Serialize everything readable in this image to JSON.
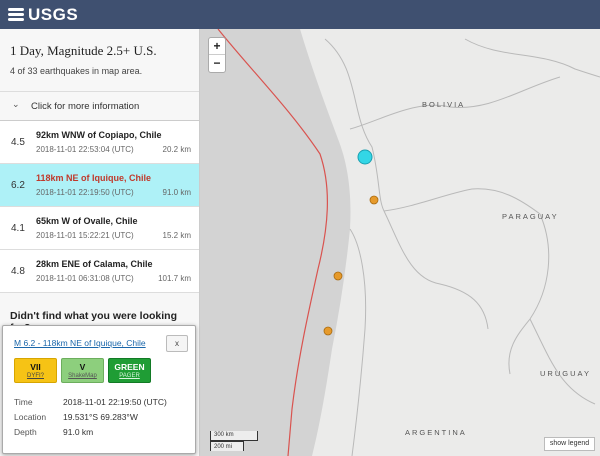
{
  "header": {
    "logo_text": "USGS"
  },
  "sidebar": {
    "title": "1 Day, Magnitude 2.5+ U.S.",
    "subtitle": "4 of 33 earthquakes in map area.",
    "more_info_label": "Click for more information",
    "earthquakes": [
      {
        "magnitude": "4.5",
        "place": "92km WNW of Copiapo, Chile",
        "time": "2018-11-01 22:53:04 (UTC)",
        "depth": "20.2 km",
        "selected": false
      },
      {
        "magnitude": "6.2",
        "place": "118km NE of Iquique, Chile",
        "time": "2018-11-01 22:19:50 (UTC)",
        "depth": "91.0 km",
        "selected": true
      },
      {
        "magnitude": "4.1",
        "place": "65km W of Ovalle, Chile",
        "time": "2018-11-01 15:22:21 (UTC)",
        "depth": "15.2 km",
        "selected": false
      },
      {
        "magnitude": "4.8",
        "place": "28km ENE of Calama, Chile",
        "time": "2018-11-01 06:31:08 (UTC)",
        "depth": "101.7 km",
        "selected": false
      }
    ],
    "didnt_find": "Didn't find what you were looking for?"
  },
  "map": {
    "zoom_in": "+",
    "zoom_out": "−",
    "labels": {
      "bolivia": "BOLIVIA",
      "paraguay": "PARAGUAY",
      "uruguay": "URUGUAY",
      "argentina": "ARGENTINA"
    },
    "scale_km": "300 km",
    "scale_mi": "200 mi",
    "legend_button": "show legend",
    "colors": {
      "selected_marker": "#33d6e6",
      "marker": "#e69a2b",
      "plate_boundary": "#d9534f"
    }
  },
  "popup": {
    "title": "M 6.2 - 118km NE of Iquique, Chile",
    "close_label": "x",
    "badges": [
      {
        "value": "VII",
        "source": "DYFI?"
      },
      {
        "value": "V",
        "source": "ShakeMap"
      },
      {
        "value": "GREEN",
        "source": "PAGER"
      }
    ],
    "details": {
      "time_label": "Time",
      "time_value": "2018-11-01 22:19:50 (UTC)",
      "location_label": "Location",
      "location_value": "19.531°S 69.283°W",
      "depth_label": "Depth",
      "depth_value": "91.0 km"
    }
  }
}
